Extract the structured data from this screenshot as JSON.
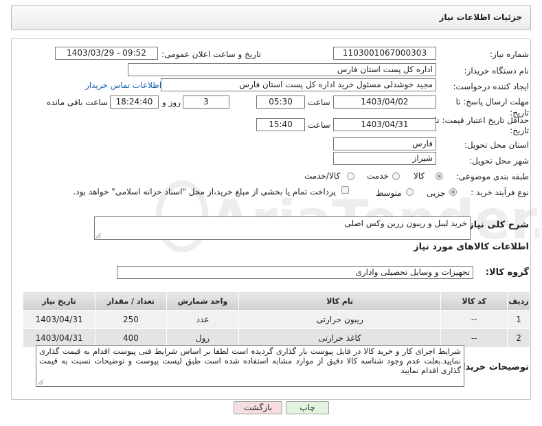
{
  "page": {
    "title": "جزئیات اطلاعات نیاز"
  },
  "fields": {
    "need_number": {
      "label": "شماره نیاز:",
      "value": "1103001067000303"
    },
    "announce_datetime": {
      "label": "تاریخ و ساعت اعلان عمومی:",
      "value": "1403/03/29 - 09:52"
    },
    "buyer_org": {
      "label": "نام دستگاه خریدار:",
      "value": "اداره کل پست استان فارس"
    },
    "requester": {
      "label": "ایجاد کننده درخواست:",
      "value": "مجید خوشدلی مسئول خرید اداره کل پست استان فارس",
      "contact_link": "اطلاعات تماس خریدار"
    },
    "reply_deadline": {
      "label_line1": "مهلت ارسال پاسخ: تا",
      "label_line2": "تاریخ:",
      "date": "1403/04/02",
      "time_label": "ساعت",
      "time": "05:30",
      "days": "3",
      "days_label": "روز و",
      "remaining": "18:24:40",
      "remaining_label": "ساعت باقی مانده"
    },
    "price_validity": {
      "label_line1": "حداقل تاریخ اعتبار قیمت: تا",
      "label_line2": "تاریخ:",
      "date": "1403/04/31",
      "time_label": "ساعت",
      "time": "15:40"
    },
    "delivery_province": {
      "label": "استان محل تحویل:",
      "value": "فارس"
    },
    "delivery_city": {
      "label": "شهر محل تحویل:",
      "value": "شیراز"
    },
    "category": {
      "label": "طبقه بندی موضوعی:",
      "options": [
        "کالا",
        "خدمت",
        "کالا/خدمت"
      ],
      "selected": "کالا"
    },
    "purchase_type": {
      "label": "نوع فرآیند خرید :",
      "options": [
        "جزیی",
        "متوسط"
      ],
      "selected": "جزیی",
      "payment_note": "پرداخت تمام یا بخشی از مبلغ خرید،از محل \"اسناد خزانه اسلامی\" خواهد بود."
    },
    "description": {
      "label": "شرح کلی نیاز:",
      "value": "خرید لیبل و ریبون زرین وکس اصلی"
    }
  },
  "goods": {
    "section_title": "اطلاعات کالاهای مورد نیاز",
    "group_label": "گروه کالا:",
    "group_value": "تجهیزات و وسایل تحصیلی واداری",
    "columns": [
      "ردیف",
      "کد کالا",
      "نام کالا",
      "واحد شمارش",
      "تعداد / مقدار",
      "تاریخ نیاز"
    ],
    "rows": [
      [
        "1",
        "--",
        "ریبون حرارتی",
        "عدد",
        "250",
        "1403/04/31"
      ],
      [
        "2",
        "--",
        "کاغذ حرارتی",
        "رول",
        "400",
        "1403/04/31"
      ]
    ]
  },
  "buyer_notes": {
    "label": "توضیحات خریدار:",
    "value": "شرایط اجرای کار و خرید کالا در فایل پیوست بار گذاری گردیده است لطفا بر اساس شرایط فنی پیوست اقدام به قیمت گذاری نمایید.بعلت عدم وجود شناسه کالا دقیق از موارد مشابه استفاده شده است طبق لیست پیوست و توضیحات نسبت به قیمت گذاری اقدام نمایید"
  },
  "buttons": {
    "print": "چاپ",
    "back": "بازگشت"
  },
  "watermark": {
    "text": "AriaTender.neT"
  },
  "colors": {
    "link": "#1a5fb4",
    "back_button_bg": "#f6dede",
    "print_button_bg": "#e4f3df"
  }
}
